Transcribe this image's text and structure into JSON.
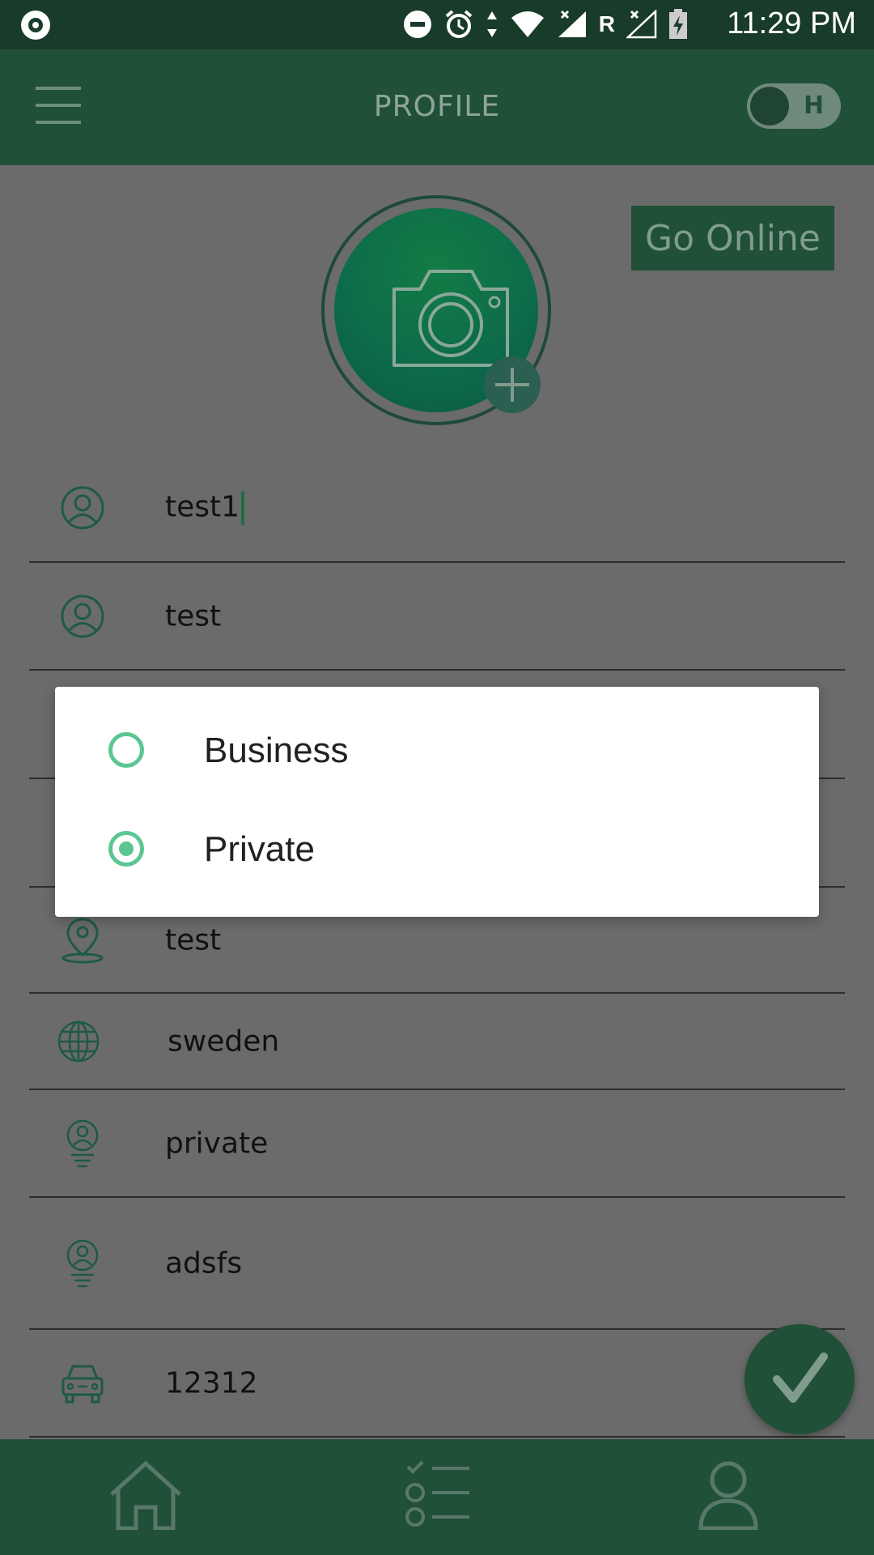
{
  "status_bar": {
    "time": "11:29 PM",
    "network_label": "R"
  },
  "header": {
    "title": "PROFILE",
    "toggle_label": "H"
  },
  "profile": {
    "go_online_label": "Go Online"
  },
  "fields": [
    {
      "icon": "user-circle-icon",
      "value": "test1"
    },
    {
      "icon": "user-circle-icon",
      "value": "test"
    },
    {
      "icon": "location-pin-icon",
      "value": "test"
    },
    {
      "icon": "globe-icon",
      "value": "sweden"
    },
    {
      "icon": "user-badge-icon",
      "value": "private"
    },
    {
      "icon": "user-badge-icon",
      "value": "adsfs"
    },
    {
      "icon": "car-icon",
      "value": "12312"
    }
  ],
  "dialog": {
    "options": [
      {
        "label": "Business",
        "selected": false
      },
      {
        "label": "Private",
        "selected": true
      }
    ]
  },
  "colors": {
    "primary": "#215038",
    "accent": "#5cc693",
    "status_bar": "#183b2a",
    "scrim_background": "#6b6b6b"
  },
  "bottom_nav": {
    "items": [
      {
        "icon": "home-icon"
      },
      {
        "icon": "checklist-icon"
      },
      {
        "icon": "user-icon"
      }
    ]
  }
}
